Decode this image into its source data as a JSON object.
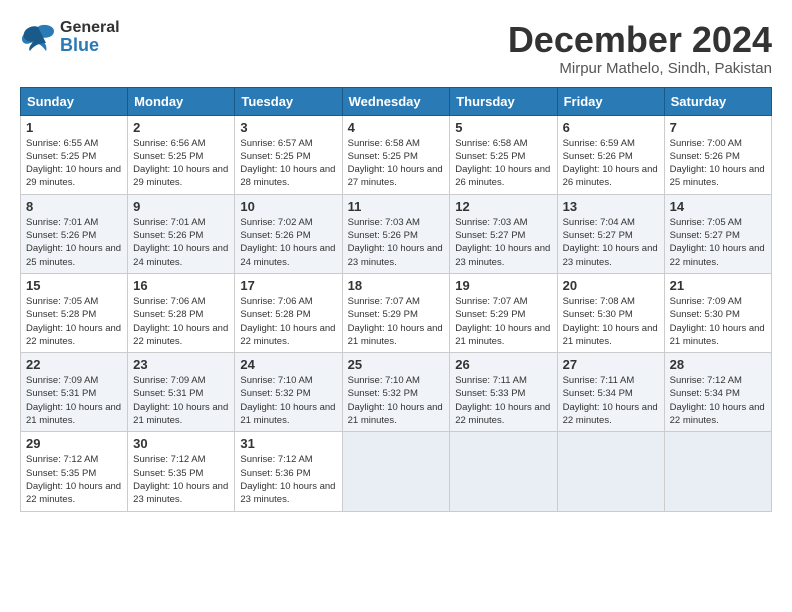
{
  "header": {
    "logo_general": "General",
    "logo_blue": "Blue",
    "month_title": "December 2024",
    "location": "Mirpur Mathelo, Sindh, Pakistan"
  },
  "weekdays": [
    "Sunday",
    "Monday",
    "Tuesday",
    "Wednesday",
    "Thursday",
    "Friday",
    "Saturday"
  ],
  "weeks": [
    [
      {
        "day": "1",
        "sunrise": "Sunrise: 6:55 AM",
        "sunset": "Sunset: 5:25 PM",
        "daylight": "Daylight: 10 hours and 29 minutes."
      },
      {
        "day": "2",
        "sunrise": "Sunrise: 6:56 AM",
        "sunset": "Sunset: 5:25 PM",
        "daylight": "Daylight: 10 hours and 29 minutes."
      },
      {
        "day": "3",
        "sunrise": "Sunrise: 6:57 AM",
        "sunset": "Sunset: 5:25 PM",
        "daylight": "Daylight: 10 hours and 28 minutes."
      },
      {
        "day": "4",
        "sunrise": "Sunrise: 6:58 AM",
        "sunset": "Sunset: 5:25 PM",
        "daylight": "Daylight: 10 hours and 27 minutes."
      },
      {
        "day": "5",
        "sunrise": "Sunrise: 6:58 AM",
        "sunset": "Sunset: 5:25 PM",
        "daylight": "Daylight: 10 hours and 26 minutes."
      },
      {
        "day": "6",
        "sunrise": "Sunrise: 6:59 AM",
        "sunset": "Sunset: 5:26 PM",
        "daylight": "Daylight: 10 hours and 26 minutes."
      },
      {
        "day": "7",
        "sunrise": "Sunrise: 7:00 AM",
        "sunset": "Sunset: 5:26 PM",
        "daylight": "Daylight: 10 hours and 25 minutes."
      }
    ],
    [
      {
        "day": "8",
        "sunrise": "Sunrise: 7:01 AM",
        "sunset": "Sunset: 5:26 PM",
        "daylight": "Daylight: 10 hours and 25 minutes."
      },
      {
        "day": "9",
        "sunrise": "Sunrise: 7:01 AM",
        "sunset": "Sunset: 5:26 PM",
        "daylight": "Daylight: 10 hours and 24 minutes."
      },
      {
        "day": "10",
        "sunrise": "Sunrise: 7:02 AM",
        "sunset": "Sunset: 5:26 PM",
        "daylight": "Daylight: 10 hours and 24 minutes."
      },
      {
        "day": "11",
        "sunrise": "Sunrise: 7:03 AM",
        "sunset": "Sunset: 5:26 PM",
        "daylight": "Daylight: 10 hours and 23 minutes."
      },
      {
        "day": "12",
        "sunrise": "Sunrise: 7:03 AM",
        "sunset": "Sunset: 5:27 PM",
        "daylight": "Daylight: 10 hours and 23 minutes."
      },
      {
        "day": "13",
        "sunrise": "Sunrise: 7:04 AM",
        "sunset": "Sunset: 5:27 PM",
        "daylight": "Daylight: 10 hours and 23 minutes."
      },
      {
        "day": "14",
        "sunrise": "Sunrise: 7:05 AM",
        "sunset": "Sunset: 5:27 PM",
        "daylight": "Daylight: 10 hours and 22 minutes."
      }
    ],
    [
      {
        "day": "15",
        "sunrise": "Sunrise: 7:05 AM",
        "sunset": "Sunset: 5:28 PM",
        "daylight": "Daylight: 10 hours and 22 minutes."
      },
      {
        "day": "16",
        "sunrise": "Sunrise: 7:06 AM",
        "sunset": "Sunset: 5:28 PM",
        "daylight": "Daylight: 10 hours and 22 minutes."
      },
      {
        "day": "17",
        "sunrise": "Sunrise: 7:06 AM",
        "sunset": "Sunset: 5:28 PM",
        "daylight": "Daylight: 10 hours and 22 minutes."
      },
      {
        "day": "18",
        "sunrise": "Sunrise: 7:07 AM",
        "sunset": "Sunset: 5:29 PM",
        "daylight": "Daylight: 10 hours and 21 minutes."
      },
      {
        "day": "19",
        "sunrise": "Sunrise: 7:07 AM",
        "sunset": "Sunset: 5:29 PM",
        "daylight": "Daylight: 10 hours and 21 minutes."
      },
      {
        "day": "20",
        "sunrise": "Sunrise: 7:08 AM",
        "sunset": "Sunset: 5:30 PM",
        "daylight": "Daylight: 10 hours and 21 minutes."
      },
      {
        "day": "21",
        "sunrise": "Sunrise: 7:09 AM",
        "sunset": "Sunset: 5:30 PM",
        "daylight": "Daylight: 10 hours and 21 minutes."
      }
    ],
    [
      {
        "day": "22",
        "sunrise": "Sunrise: 7:09 AM",
        "sunset": "Sunset: 5:31 PM",
        "daylight": "Daylight: 10 hours and 21 minutes."
      },
      {
        "day": "23",
        "sunrise": "Sunrise: 7:09 AM",
        "sunset": "Sunset: 5:31 PM",
        "daylight": "Daylight: 10 hours and 21 minutes."
      },
      {
        "day": "24",
        "sunrise": "Sunrise: 7:10 AM",
        "sunset": "Sunset: 5:32 PM",
        "daylight": "Daylight: 10 hours and 21 minutes."
      },
      {
        "day": "25",
        "sunrise": "Sunrise: 7:10 AM",
        "sunset": "Sunset: 5:32 PM",
        "daylight": "Daylight: 10 hours and 21 minutes."
      },
      {
        "day": "26",
        "sunrise": "Sunrise: 7:11 AM",
        "sunset": "Sunset: 5:33 PM",
        "daylight": "Daylight: 10 hours and 22 minutes."
      },
      {
        "day": "27",
        "sunrise": "Sunrise: 7:11 AM",
        "sunset": "Sunset: 5:34 PM",
        "daylight": "Daylight: 10 hours and 22 minutes."
      },
      {
        "day": "28",
        "sunrise": "Sunrise: 7:12 AM",
        "sunset": "Sunset: 5:34 PM",
        "daylight": "Daylight: 10 hours and 22 minutes."
      }
    ],
    [
      {
        "day": "29",
        "sunrise": "Sunrise: 7:12 AM",
        "sunset": "Sunset: 5:35 PM",
        "daylight": "Daylight: 10 hours and 22 minutes."
      },
      {
        "day": "30",
        "sunrise": "Sunrise: 7:12 AM",
        "sunset": "Sunset: 5:35 PM",
        "daylight": "Daylight: 10 hours and 23 minutes."
      },
      {
        "day": "31",
        "sunrise": "Sunrise: 7:12 AM",
        "sunset": "Sunset: 5:36 PM",
        "daylight": "Daylight: 10 hours and 23 minutes."
      },
      null,
      null,
      null,
      null
    ]
  ]
}
